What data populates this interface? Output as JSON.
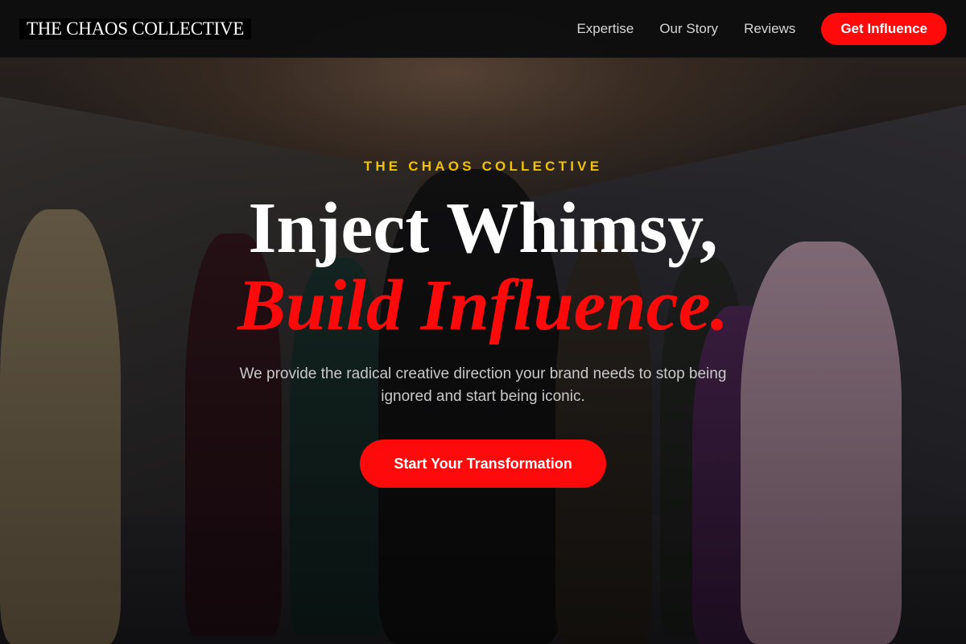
{
  "navbar": {
    "brand": "THE CHAOS COLLECTIVE",
    "links": [
      {
        "label": "Expertise"
      },
      {
        "label": "Our Story"
      },
      {
        "label": "Reviews"
      }
    ],
    "cta_label": "Get Influence"
  },
  "hero": {
    "eyebrow": "THE CHAOS COLLECTIVE",
    "headline_line1": "Inject Whimsy,",
    "headline_line2": "Build Influence.",
    "subtitle": "We provide the radical creative direction your brand needs to stop being ignored and start being iconic.",
    "cta_label": "Start Your Transformation"
  },
  "colors": {
    "accent": "#ff0a0a",
    "eyebrow": "#f2c200",
    "navbar_bg": "#0e0e0f"
  }
}
